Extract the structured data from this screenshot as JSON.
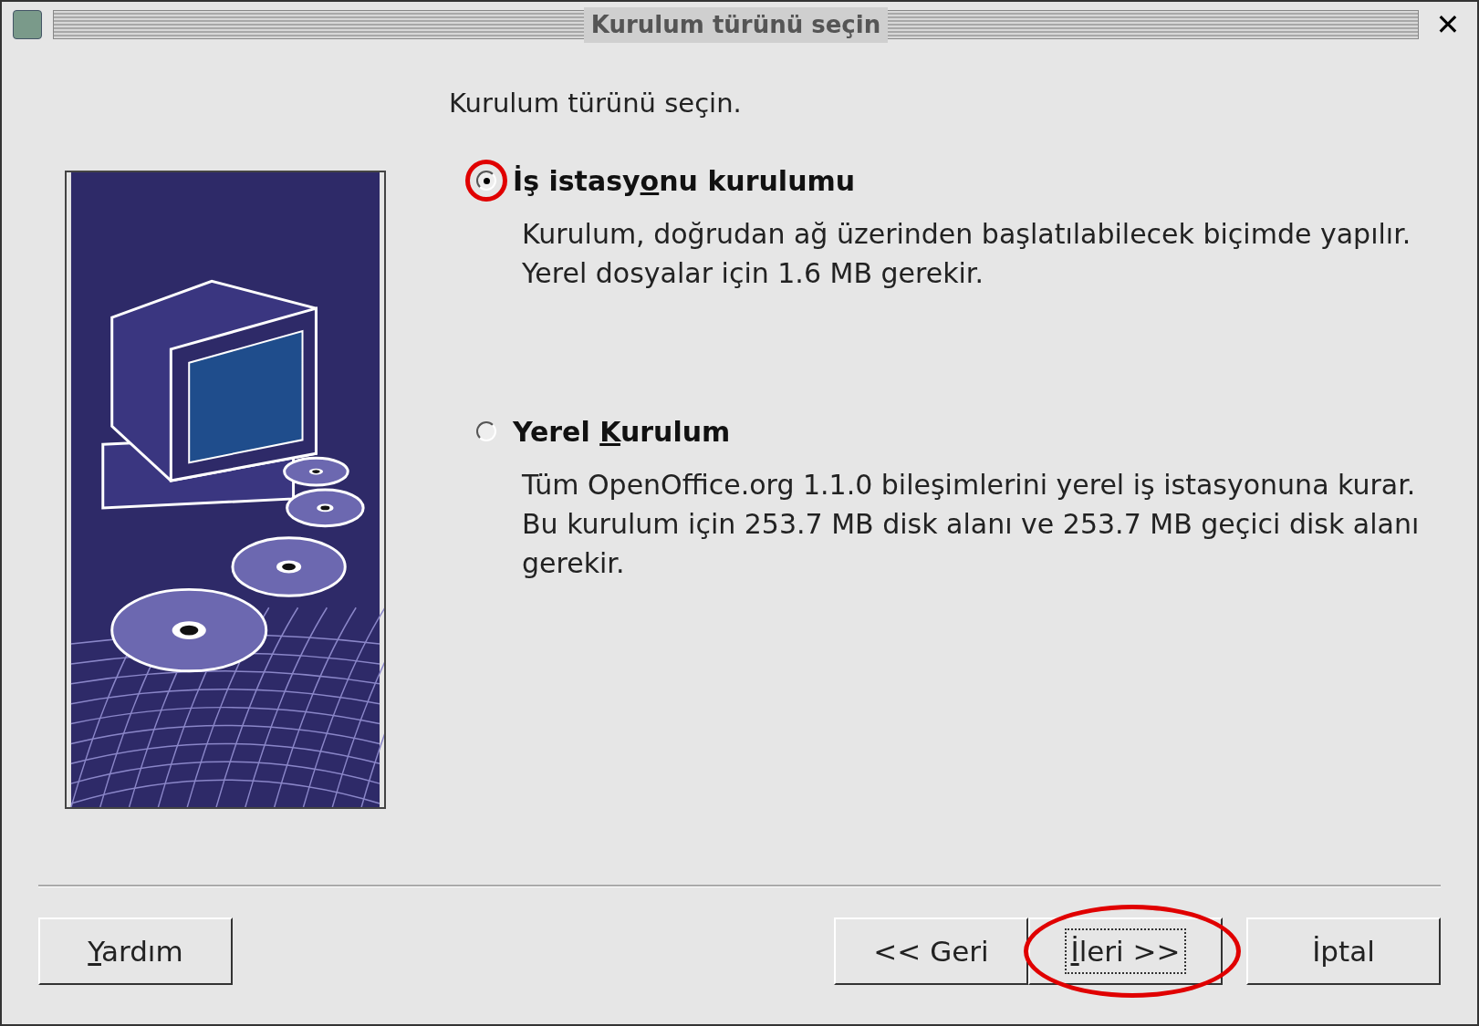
{
  "window": {
    "title": "Kurulum türünü seçin",
    "close": "✕"
  },
  "heading": "Kurulum türünü seçin.",
  "options": [
    {
      "before": "İş istasy",
      "mnemonic": "o",
      "after": "nu kurulumu",
      "selected": true,
      "annotated": true,
      "description": [
        "Kurulum, doğrudan ağ üzerinden başlatılabilecek biçimde yapılır.",
        "Yerel dosyalar için 1.6 MB gerekir."
      ]
    },
    {
      "before": "Yerel ",
      "mnemonic": "K",
      "after": "urulum",
      "selected": false,
      "annotated": false,
      "description": [
        "Tüm OpenOffice.org 1.1.0 bileşimlerini yerel iş istasyonuna kurar.",
        "Bu kurulum için 253.7 MB disk alanı ve 253.7 MB geçici disk alanı",
        "gerekir."
      ]
    }
  ],
  "buttons": [
    {
      "mnemonic": "Y",
      "after": "ardım",
      "focused": false,
      "annotated": false
    },
    {
      "before": "<< Geri",
      "focused": false,
      "annotated": false
    },
    {
      "mnemonic": "İ",
      "after": "leri >>",
      "focused": true,
      "annotated": true
    },
    {
      "after": "İptal",
      "focused": false,
      "annotated": false
    }
  ]
}
